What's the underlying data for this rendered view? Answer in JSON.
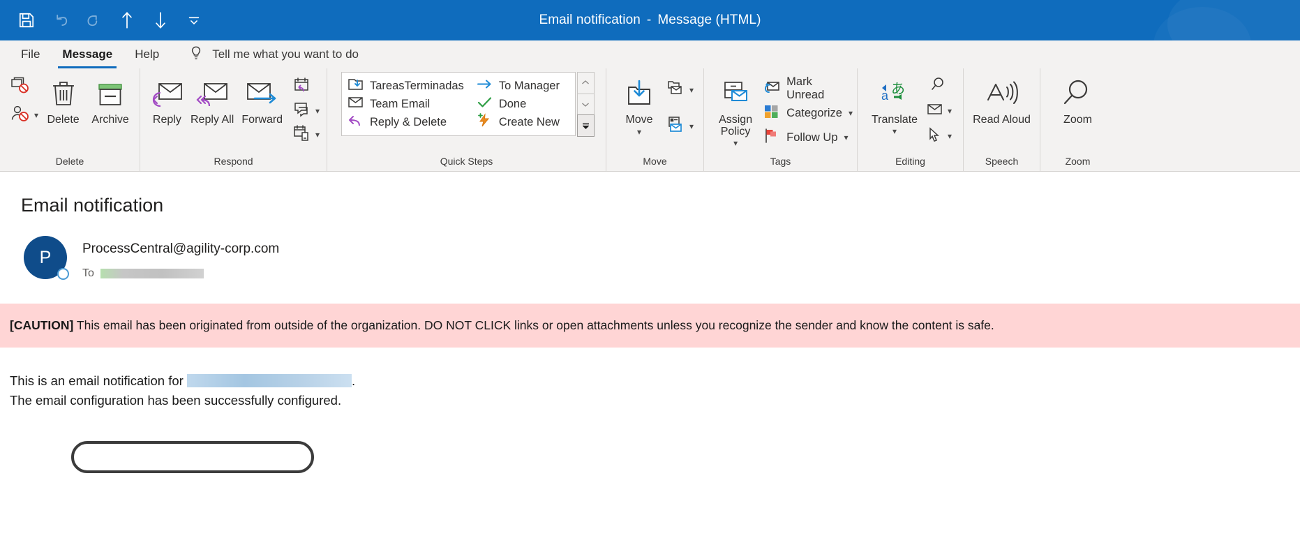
{
  "window": {
    "title": "Email notification",
    "separator": "-",
    "doc_type": "Message (HTML)",
    "quick_access": [
      {
        "name": "save-icon",
        "label": "Save"
      },
      {
        "name": "undo-icon",
        "label": "Undo"
      },
      {
        "name": "redo-icon",
        "label": "Redo"
      },
      {
        "name": "previous-item-icon",
        "label": "Previous Item"
      },
      {
        "name": "next-item-icon",
        "label": "Next Item"
      },
      {
        "name": "customize-quick-access-toolbar-icon",
        "label": "Customize Quick Access Toolbar"
      }
    ]
  },
  "tabs": [
    {
      "label": "File",
      "active": false
    },
    {
      "label": "Message",
      "active": true
    },
    {
      "label": "Help",
      "active": false
    }
  ],
  "tellme": {
    "icon": "lightbulb-icon",
    "placeholder": "Tell me what you want to do"
  },
  "ribbon": {
    "groups": [
      {
        "label": "Delete",
        "small_buttons": [
          {
            "label": "Ignore",
            "icon": "ignore-icon"
          },
          {
            "label": "Junk",
            "icon": "junk-person-icon",
            "has_dropdown": true
          }
        ],
        "big_buttons": [
          {
            "label": "Delete",
            "icon": "trash-icon"
          },
          {
            "label": "Archive",
            "icon": "archive-box-icon"
          }
        ]
      },
      {
        "label": "Respond",
        "big_buttons": [
          {
            "label": "Reply",
            "icon": "reply-icon"
          },
          {
            "label": "Reply All",
            "icon": "reply-all-icon"
          },
          {
            "label": "Forward",
            "icon": "forward-icon"
          }
        ],
        "small_buttons": [
          {
            "label": "Meeting",
            "icon": "calendar-reply-icon"
          },
          {
            "label": "IM",
            "icon": "chat-bubbles-icon",
            "has_dropdown": true
          },
          {
            "label": "More Respond Actions",
            "icon": "calendar-device-icon",
            "has_dropdown": true
          }
        ]
      },
      {
        "label": "Quick Steps",
        "has_launcher": true,
        "items_col1": [
          {
            "label": "TareasTerminadas",
            "icon": "move-to-folder-icon"
          },
          {
            "label": "Team Email",
            "icon": "envelope-icon"
          },
          {
            "label": "Reply & Delete",
            "icon": "reply-delete-icon"
          }
        ],
        "items_col2": [
          {
            "label": "To Manager",
            "icon": "arrow-right-icon"
          },
          {
            "label": "Done",
            "icon": "checkmark-icon"
          },
          {
            "label": "Create New",
            "icon": "lightning-new-icon"
          }
        ],
        "scroll": [
          {
            "name": "quick-steps-scroll-up",
            "glyph": "⌃"
          },
          {
            "name": "quick-steps-scroll-down",
            "glyph": "⌄"
          },
          {
            "name": "quick-steps-more",
            "glyph": "⌄"
          }
        ]
      },
      {
        "label": "Move",
        "big_buttons": [
          {
            "label": "Move",
            "icon": "move-folder-icon",
            "has_dropdown": true
          }
        ],
        "small_buttons": [
          {
            "label": "Rules",
            "icon": "rules-folder-envelope-icon",
            "has_dropdown": true
          },
          {
            "label": "OneNote",
            "icon": "onenote-envelope-icon",
            "has_dropdown": true
          }
        ]
      },
      {
        "label": "Tags",
        "has_launcher": true,
        "big_buttons": [
          {
            "label": "Assign Policy",
            "icon": "assign-policy-icon",
            "has_dropdown": true
          }
        ],
        "rows": [
          {
            "label": "Mark Unread",
            "icon": "mark-unread-icon",
            "has_dropdown": false
          },
          {
            "label": "Categorize",
            "icon": "categorize-icon",
            "has_dropdown": true
          },
          {
            "label": "Follow Up",
            "icon": "follow-up-flag-icon",
            "has_dropdown": true
          }
        ]
      },
      {
        "label": "Editing",
        "big_buttons": [
          {
            "label": "Translate",
            "icon": "translate-icon",
            "has_dropdown": true
          }
        ],
        "small_buttons": [
          {
            "label": "Find",
            "icon": "magnifier-icon"
          },
          {
            "label": "Related",
            "icon": "envelope-related-icon",
            "has_dropdown": true
          },
          {
            "label": "Select",
            "icon": "select-cursor-icon",
            "has_dropdown": true
          }
        ]
      },
      {
        "label": "Speech",
        "big_buttons": [
          {
            "label": "Read Aloud",
            "icon": "read-aloud-icon"
          }
        ]
      },
      {
        "label": "Zoom",
        "big_buttons": [
          {
            "label": "Zoom",
            "icon": "zoom-magnifier-icon"
          }
        ]
      }
    ]
  },
  "message": {
    "subject": "Email notification",
    "avatar_initial": "P",
    "sender_email": "ProcessCentral@agility-corp.com",
    "to_label": "To",
    "to_value_redacted": true,
    "caution": {
      "tag": "[CAUTION]",
      "text": "This email has been originated from outside of the organization. DO NOT CLICK links or open attachments unless you recognize the sender and know the content is safe."
    },
    "body_line1_prefix": "This is an email notification for ",
    "body_line1_redacted": true,
    "body_line1_suffix": ".",
    "body_line2": "The email configuration has been successfully configured."
  },
  "colors": {
    "titlebar": "#0f6cbd",
    "ribbon_bg": "#f3f2f1",
    "accent": "#0f6cbd",
    "caution_bg": "#ffd5d5",
    "avatar_bg": "#0f4c8a",
    "annotation_stroke": "#3b3b3b"
  }
}
